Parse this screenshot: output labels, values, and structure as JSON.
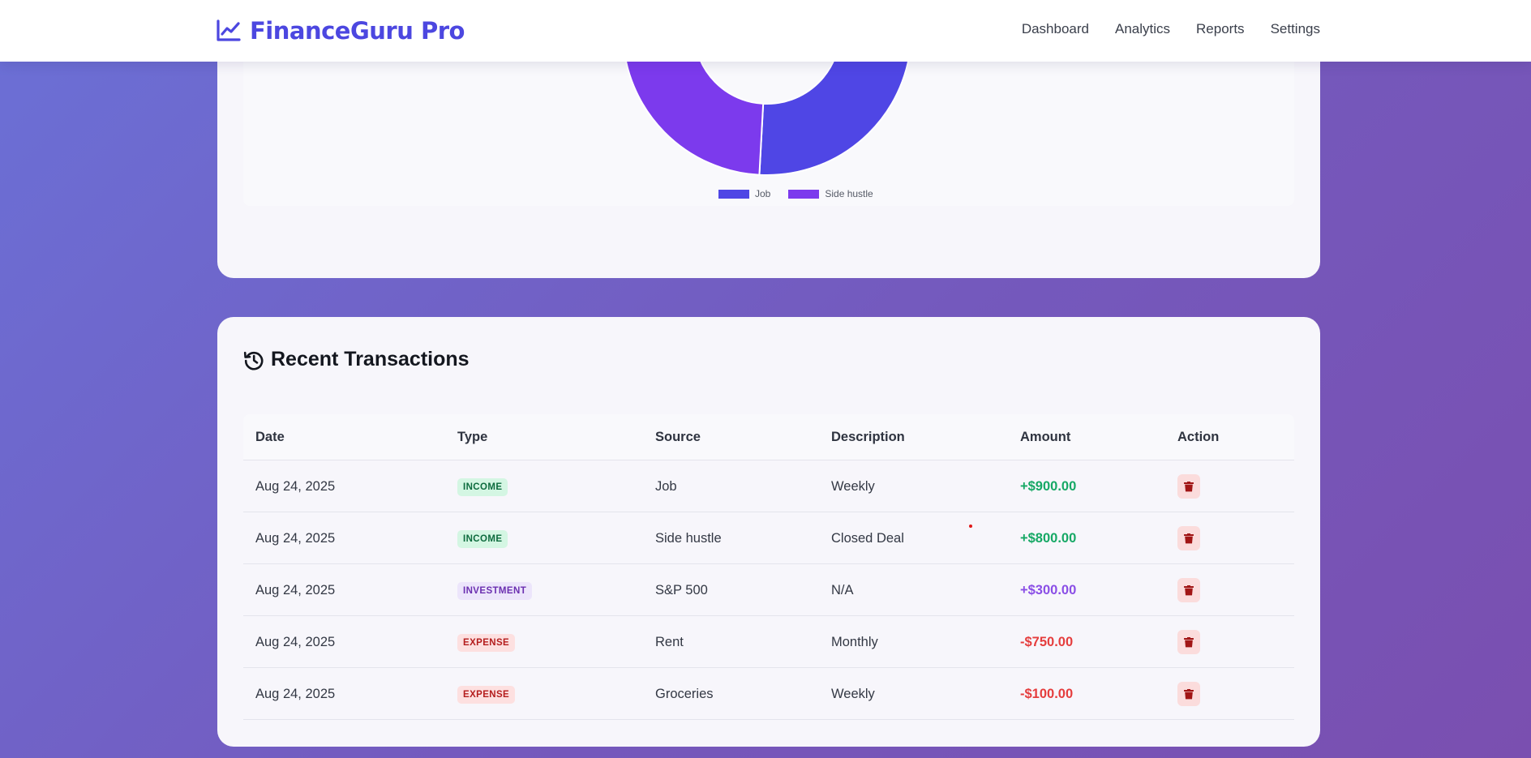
{
  "header": {
    "brand_name": "FinanceGuru Pro",
    "brand_icon": "chart-line-icon",
    "nav": [
      "Dashboard",
      "Analytics",
      "Reports",
      "Settings"
    ]
  },
  "colors": {
    "brand": "#4c47e0",
    "job": "#4f46e5",
    "side_hustle": "#7c3aed",
    "income": "#16a865",
    "investment": "#8a4ee6",
    "expense": "#e53d3d"
  },
  "chart_data": {
    "type": "pie",
    "categories": [
      "Job",
      "Side hustle"
    ],
    "values": [
      900,
      800
    ],
    "colors": [
      "#4f46e5",
      "#7c3aed"
    ],
    "legend_position": "bottom"
  },
  "transactions": {
    "title": "Recent Transactions",
    "title_icon": "history-icon",
    "columns": [
      "Date",
      "Type",
      "Source",
      "Description",
      "Amount",
      "Action"
    ],
    "rows": [
      {
        "date": "Aug 24, 2025",
        "type": "INCOME",
        "kind": "income",
        "source": "Job",
        "description": "Weekly",
        "amount": "+$900.00"
      },
      {
        "date": "Aug 24, 2025",
        "type": "INCOME",
        "kind": "income",
        "source": "Side hustle",
        "description": "Closed Deal",
        "amount": "+$800.00"
      },
      {
        "date": "Aug 24, 2025",
        "type": "INVESTMENT",
        "kind": "investment",
        "source": "S&P 500",
        "description": "N/A",
        "amount": "+$300.00"
      },
      {
        "date": "Aug 24, 2025",
        "type": "EXPENSE",
        "kind": "expense",
        "source": "Rent",
        "description": "Monthly",
        "amount": "-$750.00"
      },
      {
        "date": "Aug 24, 2025",
        "type": "EXPENSE",
        "kind": "expense",
        "source": "Groceries",
        "description": "Weekly",
        "amount": "-$100.00"
      }
    ],
    "action_icon": "trash-icon"
  }
}
